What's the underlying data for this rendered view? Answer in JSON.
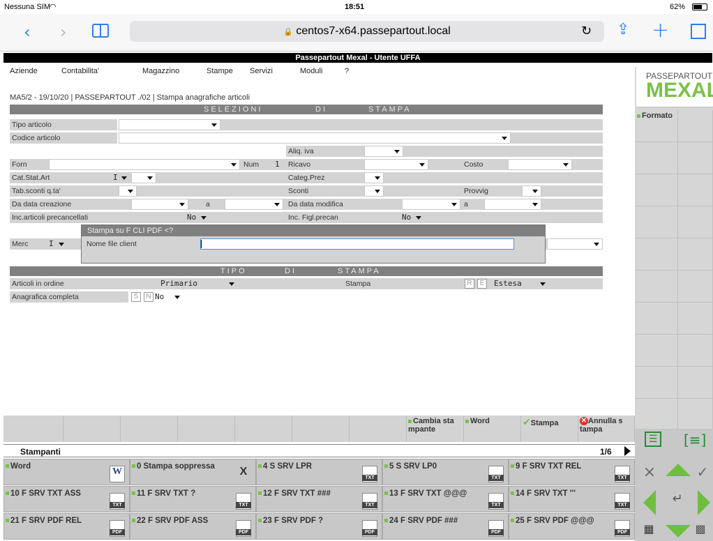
{
  "status_bar": {
    "carrier": "Nessuna SIM",
    "wifi": "wifi-icon",
    "time": "18:51",
    "battery": "62%"
  },
  "browser": {
    "url": "centos7-x64.passepartout.local",
    "lock": "🔒"
  },
  "app": {
    "title": "Passepartout Mexal - Utente UFFA"
  },
  "menu": [
    "Aziende",
    "Contabilita'",
    "Magazzino",
    "Stampe",
    "Servizi",
    "Moduli",
    "?"
  ],
  "breadcrumb": "MA5/2 - 19/10/20 | PASSEPARTOUT ./02 | Stampa anagrafiche articoli",
  "logo": {
    "top": "PASSEPARTOUT",
    "bottom": "MEXAL"
  },
  "sections": {
    "selezioni": [
      "SELEZIONI",
      "DI",
      "STAMPA"
    ],
    "tipo": [
      "TIPO",
      "DI",
      "STAMPA"
    ]
  },
  "form": {
    "tipo_articolo": "Tipo articolo",
    "codice_articolo": "Codice articolo",
    "aliq_iva": "Aliq. iva",
    "forn": "Forn",
    "num": "Num",
    "num_value": "1",
    "ricavo": "Ricavo",
    "costo": "Costo",
    "cat_stat_art": "Cat.Stat.Art",
    "cat_stat_value": "I",
    "categ_prez": "Categ.Prez",
    "tab_sconti": "Tab.sconti q.ta'",
    "sconti": "Sconti",
    "provvig": "Provvig",
    "da_data_creazione": "Da data creazione",
    "a1": "a",
    "da_data_modifica": "Da data modifica",
    "a2": "a",
    "inc_precancellati": "Inc.articoli precancellati",
    "inc_precancellati_value": "No",
    "inc_figl": "Inc. Figl.precan",
    "inc_figl_value": "No",
    "merc": "Merc",
    "merc_value": "I"
  },
  "dialog": {
    "title": "Stampa su F CLI PDF <?",
    "label": "Nome file client",
    "value": ""
  },
  "tipo_stampa": {
    "articoli_in_ordine": "Articoli in ordine",
    "articoli_value": "Primario",
    "stampa": "Stampa",
    "stampa_keys": [
      "R",
      "E"
    ],
    "stampa_value": "Estesa",
    "anagrafica_completa": "Anagrafica completa",
    "anagrafica_keys": [
      "S",
      "N"
    ],
    "anagrafica_value": "No"
  },
  "right_panel": {
    "formato": "Formato"
  },
  "function_bar": [
    {
      "label": "Cambia sta mpante",
      "icon": "green-square"
    },
    {
      "label": "Word",
      "icon": "green-square"
    },
    {
      "label": "Stampa",
      "icon": "check-icon"
    },
    {
      "label": "Annulla s tampa",
      "icon": "cancel-icon"
    }
  ],
  "printers": {
    "title": "Stampanti",
    "page": "1/6",
    "items": [
      {
        "label": "Word",
        "badge": "W"
      },
      {
        "label": "0 Stampa soppressa",
        "badge": "X"
      },
      {
        "label": "4 S SRV LPR",
        "badge": "TXT"
      },
      {
        "label": "5 S SRV LP0",
        "badge": "TXT"
      },
      {
        "label": "9 F SRV TXT REL",
        "badge": "TXT"
      },
      {
        "label": "10 F SRV TXT ASS",
        "badge": "TXT"
      },
      {
        "label": "11 F SRV TXT ?",
        "badge": "TXT"
      },
      {
        "label": "12 F SRV TXT ###",
        "badge": "TXT"
      },
      {
        "label": "13 F SRV TXT @@@",
        "badge": "TXT"
      },
      {
        "label": "14 F SRV TXT '''",
        "badge": "TXT"
      },
      {
        "label": "21 F SRV PDF REL",
        "badge": "PDF"
      },
      {
        "label": "22 F SRV PDF ASS",
        "badge": "PDF"
      },
      {
        "label": "23 F SRV PDF ?",
        "badge": "PDF"
      },
      {
        "label": "24 F SRV PDF ###",
        "badge": "PDF"
      },
      {
        "label": "25 F SRV PDF @@@",
        "badge": "PDF"
      }
    ]
  },
  "colors": {
    "accent": "#2f7cf6",
    "green": "#7cc04a",
    "band": "#808080",
    "field_bg": "#d3d3d3"
  }
}
